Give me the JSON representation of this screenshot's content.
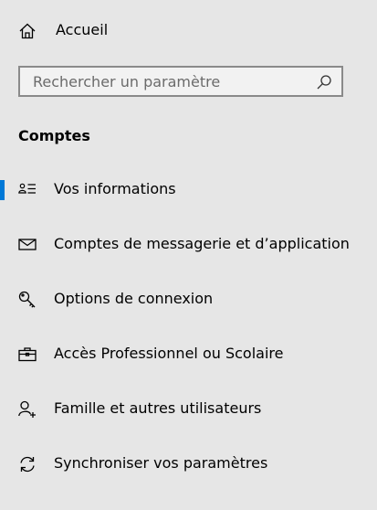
{
  "home": {
    "label": "Accueil",
    "icon": "home-icon"
  },
  "search": {
    "placeholder": "Rechercher un paramètre",
    "value": "",
    "icon": "search-icon"
  },
  "section": {
    "title": "Comptes"
  },
  "nav": {
    "accent_color": "#0078d7",
    "selected_index": 0,
    "items": [
      {
        "label": "Vos informations",
        "icon": "person-info-icon",
        "selected": true
      },
      {
        "label": "Comptes de messagerie et d’application",
        "icon": "mail-icon",
        "selected": false
      },
      {
        "label": "Options de connexion",
        "icon": "key-icon",
        "selected": false
      },
      {
        "label": "Accès Professionnel ou Scolaire",
        "icon": "briefcase-icon",
        "selected": false
      },
      {
        "label": "Famille et autres utilisateurs",
        "icon": "person-add-icon",
        "selected": false
      },
      {
        "label": "Synchroniser vos paramètres",
        "icon": "sync-icon",
        "selected": false
      }
    ]
  }
}
